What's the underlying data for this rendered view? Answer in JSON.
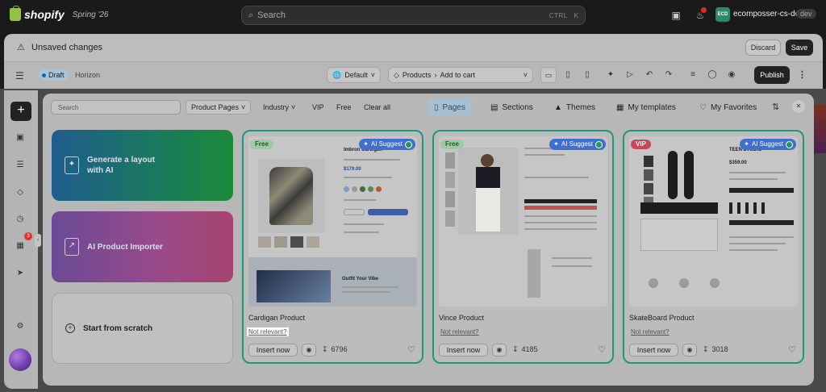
{
  "topbar": {
    "brand": "shopify",
    "season": "Spring '26",
    "search_placeholder": "Search",
    "shortcut_ctrl": "CTRL",
    "shortcut_k": "K",
    "store_initials": "ECD",
    "store_name": "ecomposser-cs-dev",
    "store_tag": "dev"
  },
  "unsaved_bar": {
    "title": "Unsaved changes",
    "discard": "Discard",
    "save": "Save"
  },
  "editor": {
    "status": "Draft",
    "theme": "Horizon",
    "template_select": "Default",
    "breadcrumb_parent": "Products",
    "breadcrumb_child": "Add to cart",
    "publish": "Publish"
  },
  "rail": {
    "notification_count": "3"
  },
  "library": {
    "search_placeholder": "Search",
    "filters": [
      "Product Pages",
      "Industry",
      "VIP",
      "Free",
      "Clear all"
    ],
    "tabs": [
      "Pages",
      "Sections",
      "Themes",
      "My templates",
      "My Favorites"
    ],
    "active_tab": "Pages",
    "tiles": {
      "generate": "Generate a layout with AI",
      "importer": "AI Product Importer",
      "scratch": "Start from scratch"
    },
    "cards": [
      {
        "name": "Cardigan Product",
        "ribbon": "Free",
        "ai": "AI Suggest",
        "not_relevant": "Not relevant?",
        "insert": "Insert now",
        "downloads": "6796",
        "thumb_title": "Imbron Cardigan",
        "thumb_price": "$179.00",
        "thumb_banner": "Outfit Your Vibe"
      },
      {
        "name": "Vince Product",
        "ribbon": "Free",
        "ai": "AI Suggest",
        "not_relevant": "Not relevant?",
        "insert": "Insert now",
        "downloads": "4185"
      },
      {
        "name": "SkateBoard Product",
        "ribbon": "VIP",
        "ai": "AI Suggest",
        "not_relevant": "Not relevant?",
        "insert": "Insert now",
        "downloads": "3018",
        "thumb_title": "TEEN STUDIO",
        "thumb_price": "$359.00"
      }
    ]
  },
  "colors": {
    "accent_green": "#1b9a7a",
    "ai_blue": "#3f6fd1",
    "vip_red": "#c9475a"
  }
}
